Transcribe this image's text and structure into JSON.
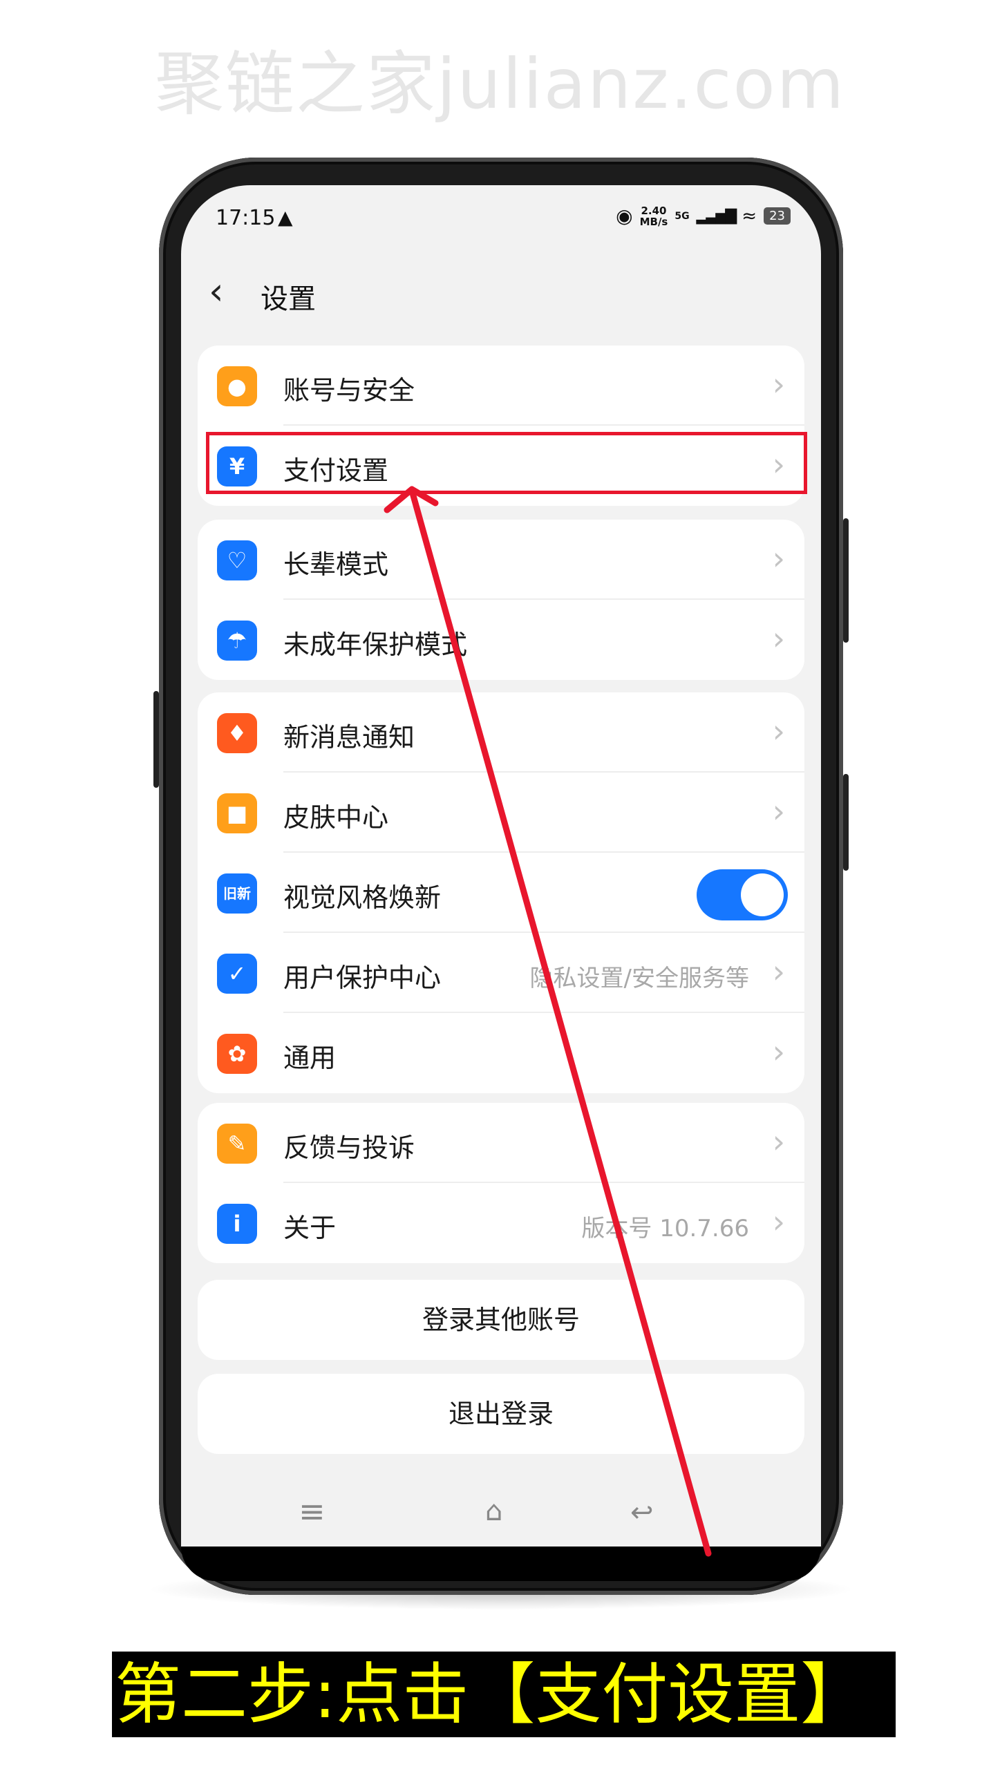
{
  "watermark": "聚链之家julianz.com",
  "status_bar": {
    "time": "17:15",
    "notification_icon": "qq-penguin-icon",
    "speed_value": "2.40",
    "speed_unit": "MB/s",
    "network": "5G",
    "battery": "23"
  },
  "header": {
    "back_icon": "chevron-left-icon",
    "title": "设置"
  },
  "groups": [
    {
      "items": [
        {
          "label": "账号与安全",
          "icon": "user-icon",
          "color": "#ff9f1a"
        },
        {
          "label": "支付设置",
          "icon": "yen-icon",
          "color": "#1677ff"
        }
      ]
    },
    {
      "items": [
        {
          "label": "长辈模式",
          "icon": "heart-icon",
          "color": "#1677ff"
        },
        {
          "label": "未成年保护模式",
          "icon": "umbrella-icon",
          "color": "#1677ff"
        }
      ]
    },
    {
      "items": [
        {
          "label": "新消息通知",
          "icon": "bell-icon",
          "color": "#ff5a1f"
        },
        {
          "label": "皮肤中心",
          "icon": "shirt-icon",
          "color": "#ff9f1a"
        },
        {
          "label": "视觉风格焕新",
          "icon": "refresh-icon",
          "color": "#1677ff",
          "icon_text": "旧新",
          "toggle_on": true
        },
        {
          "label": "用户保护中心",
          "icon": "shield-icon",
          "color": "#1677ff",
          "value": "隐私设置/安全服务等"
        },
        {
          "label": "通用",
          "icon": "gear-icon",
          "color": "#ff5a1f"
        }
      ]
    },
    {
      "items": [
        {
          "label": "反馈与投诉",
          "icon": "pen-icon",
          "color": "#ff9f1a"
        },
        {
          "label": "关于",
          "icon": "info-icon",
          "color": "#1677ff",
          "value": "版本号 10.7.66"
        }
      ]
    }
  ],
  "buttons": {
    "switch_account": "登录其他账号",
    "logout": "退出登录"
  },
  "navbar": {
    "menu_icon": "menu-icon",
    "home_icon": "home-icon",
    "back_icon": "return-icon"
  },
  "annotation": {
    "caption": "第二步:点击【支付设置】",
    "highlight_color": "#e8162d",
    "caption_color": "#ffff00"
  }
}
